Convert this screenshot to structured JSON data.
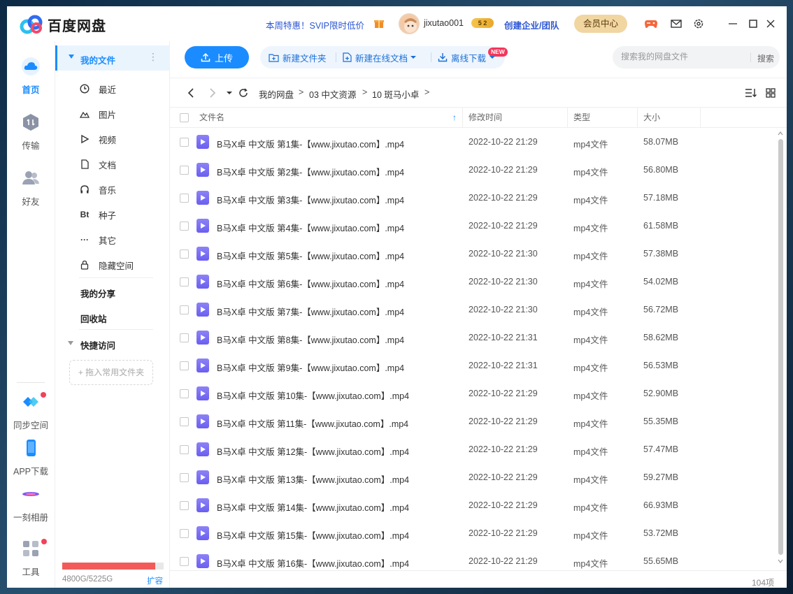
{
  "app": {
    "brand": "百度网盘",
    "promo": "本周特惠！SVIP限时低价",
    "username": "jixutao001",
    "vip_badge": "5 2",
    "enterprise": "创建企业/团队",
    "member_center": "会员中心",
    "brand_color": "#1a8cff"
  },
  "rail": {
    "items": [
      {
        "label": "首页",
        "icon": "cloud-home-icon",
        "active": true
      },
      {
        "label": "传输",
        "icon": "transfer-icon"
      },
      {
        "label": "好友",
        "icon": "friends-icon"
      },
      {
        "label": "同步空间",
        "icon": "sync-space-icon"
      },
      {
        "label": "APP下载",
        "icon": "phone-icon"
      },
      {
        "label": "一刻相册",
        "icon": "album-icon"
      },
      {
        "label": "工具",
        "icon": "tools-icon"
      }
    ]
  },
  "sidebar": {
    "my_files": "我的文件",
    "items": [
      {
        "label": "最近",
        "icon": "clock-icon"
      },
      {
        "label": "图片",
        "icon": "image-icon"
      },
      {
        "label": "视频",
        "icon": "play-icon"
      },
      {
        "label": "文档",
        "icon": "document-icon"
      },
      {
        "label": "音乐",
        "icon": "headphones-icon"
      },
      {
        "label": "种子",
        "icon": "bt-icon",
        "glyph": "Bt"
      },
      {
        "label": "其它",
        "icon": "more-icon"
      },
      {
        "label": "隐藏空间",
        "icon": "lock-icon"
      }
    ],
    "my_share": "我的分享",
    "recycle": "回收站",
    "quick_access": "快捷访问",
    "drop_hint": "+ 拖入常用文件夹",
    "storage_text": "4800G/5225G",
    "storage_used_fraction": 0.9187,
    "expand": "扩容"
  },
  "toolbar": {
    "upload": "上传",
    "new_folder": "新建文件夹",
    "new_online_doc": "新建在线文档",
    "new_badge": "NEW",
    "offline_download": "离线下载",
    "search_placeholder": "搜索我的网盘文件",
    "search_button": "搜索"
  },
  "breadcrumb": {
    "items": [
      "我的网盘",
      "03 中文资源",
      "10 斑马小卓"
    ],
    "separator": ">"
  },
  "table": {
    "headers": {
      "name": "文件名",
      "modified": "修改时间",
      "type": "类型",
      "size": "大小"
    },
    "rows": [
      {
        "name": "B马X卓 中文版 第1集-【www.jixutao.com】.mp4",
        "modified": "2022-10-22 21:29",
        "type": "mp4文件",
        "size": "58.07MB"
      },
      {
        "name": "B马X卓 中文版 第2集-【www.jixutao.com】.mp4",
        "modified": "2022-10-22 21:29",
        "type": "mp4文件",
        "size": "56.80MB"
      },
      {
        "name": "B马X卓 中文版 第3集-【www.jixutao.com】.mp4",
        "modified": "2022-10-22 21:29",
        "type": "mp4文件",
        "size": "57.18MB"
      },
      {
        "name": "B马X卓 中文版 第4集-【www.jixutao.com】.mp4",
        "modified": "2022-10-22 21:29",
        "type": "mp4文件",
        "size": "61.58MB"
      },
      {
        "name": "B马X卓 中文版 第5集-【www.jixutao.com】.mp4",
        "modified": "2022-10-22 21:30",
        "type": "mp4文件",
        "size": "57.38MB"
      },
      {
        "name": "B马X卓 中文版 第6集-【www.jixutao.com】.mp4",
        "modified": "2022-10-22 21:30",
        "type": "mp4文件",
        "size": "54.02MB"
      },
      {
        "name": "B马X卓 中文版 第7集-【www.jixutao.com】.mp4",
        "modified": "2022-10-22 21:30",
        "type": "mp4文件",
        "size": "56.72MB"
      },
      {
        "name": "B马X卓 中文版 第8集-【www.jixutao.com】.mp4",
        "modified": "2022-10-22 21:31",
        "type": "mp4文件",
        "size": "58.62MB"
      },
      {
        "name": "B马X卓 中文版 第9集-【www.jixutao.com】.mp4",
        "modified": "2022-10-22 21:31",
        "type": "mp4文件",
        "size": "56.53MB"
      },
      {
        "name": "B马X卓 中文版 第10集-【www.jixutao.com】.mp4",
        "modified": "2022-10-22 21:29",
        "type": "mp4文件",
        "size": "52.90MB"
      },
      {
        "name": "B马X卓 中文版 第11集-【www.jixutao.com】.mp4",
        "modified": "2022-10-22 21:29",
        "type": "mp4文件",
        "size": "55.35MB"
      },
      {
        "name": "B马X卓 中文版 第12集-【www.jixutao.com】.mp4",
        "modified": "2022-10-22 21:29",
        "type": "mp4文件",
        "size": "57.47MB"
      },
      {
        "name": "B马X卓 中文版 第13集-【www.jixutao.com】.mp4",
        "modified": "2022-10-22 21:29",
        "type": "mp4文件",
        "size": "59.27MB"
      },
      {
        "name": "B马X卓 中文版 第14集-【www.jixutao.com】.mp4",
        "modified": "2022-10-22 21:29",
        "type": "mp4文件",
        "size": "66.93MB"
      },
      {
        "name": "B马X卓 中文版 第15集-【www.jixutao.com】.mp4",
        "modified": "2022-10-22 21:29",
        "type": "mp4文件",
        "size": "53.72MB"
      },
      {
        "name": "B马X卓 中文版 第16集-【www.jixutao.com】.mp4",
        "modified": "2022-10-22 21:29",
        "type": "mp4文件",
        "size": "55.65MB"
      }
    ],
    "count": "104项"
  }
}
